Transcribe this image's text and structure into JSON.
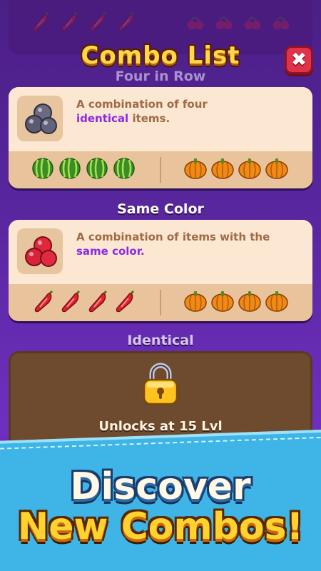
{
  "header": {
    "title": "Combo List",
    "close_label": "✖"
  },
  "combos": [
    {
      "label": "Four in Row",
      "desc_pre": "A combination of four",
      "desc_hl": "identical",
      "desc_post": "items.",
      "icon": "gray-balls-icon",
      "left_items": "watermelon-icon",
      "right_items": "pumpkin-icon"
    },
    {
      "label": "Same Color",
      "desc_pre": "A combination of items with the",
      "desc_hl": "same color.",
      "desc_post": "",
      "icon": "red-balls-icon",
      "left_items": "red-chili-icon",
      "right_items": "pumpkin-icon"
    },
    {
      "label": "Identical",
      "locked_text": "Unlocks at 15 Lvl",
      "icon": "padlock-icon"
    }
  ],
  "banner": {
    "line1": "Discover",
    "line2": "New Combos!"
  },
  "colors": {
    "accent_yellow": "#ffd84a",
    "highlight_purple": "#8a2be2",
    "close_red": "#e0324a",
    "banner_blue": "#3eb5e6"
  }
}
